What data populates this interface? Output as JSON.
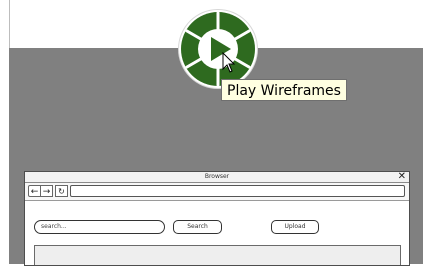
{
  "tooltip": {
    "text": "Play Wireframes"
  },
  "play_button": {
    "icon": "play-icon",
    "color": "#2e6a1f"
  },
  "browser": {
    "title": "Browser",
    "close_glyph": "✕",
    "nav": {
      "back": "←",
      "forward": "→",
      "reload": "↻"
    },
    "search_placeholder": "search...",
    "search_button": "Search",
    "upload_button": "Upload"
  }
}
